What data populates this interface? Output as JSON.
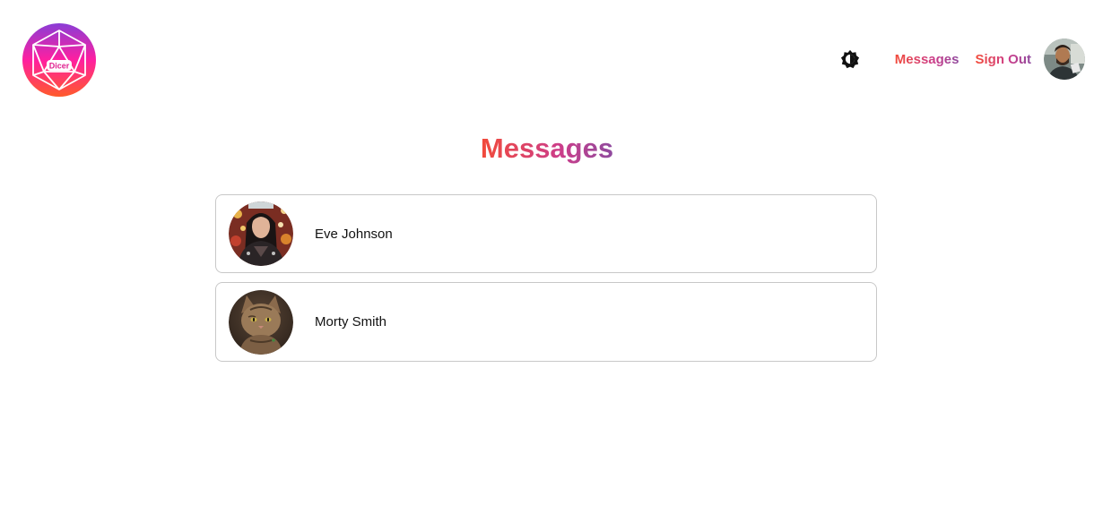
{
  "header": {
    "logo_text": "Dicer",
    "theme_toggle_icon": "brightness-icon",
    "nav": {
      "messages_label": "Messages",
      "signout_label": "Sign Out"
    },
    "user_avatar_icon": "user-avatar"
  },
  "main": {
    "title": "Messages",
    "conversations": [
      {
        "name": "Eve Johnson",
        "avatar_icon": "avatar-eve-johnson"
      },
      {
        "name": "Morty Smith",
        "avatar_icon": "avatar-morty-smith"
      }
    ]
  },
  "colors": {
    "gradient_start": "#f24b3a",
    "gradient_mid": "#cc3d8a",
    "gradient_end": "#8e4a9e",
    "logo_gradient_top": "#8a3dd6",
    "logo_gradient_mid": "#ff1fa0",
    "logo_gradient_bottom": "#ff5a2a",
    "card_border": "#c8c8c8"
  }
}
